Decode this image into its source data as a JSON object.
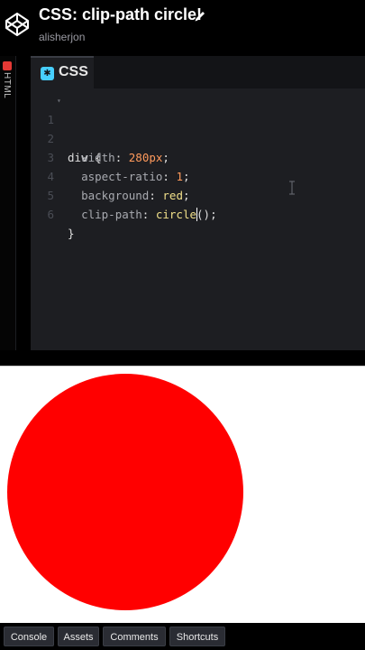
{
  "header": {
    "title": "CSS: clip-path circle!",
    "author": "alisherjon"
  },
  "side_panel": {
    "label": "HTML"
  },
  "editor": {
    "tab_label": "CSS",
    "line_numbers": [
      "1",
      "2",
      "3",
      "4",
      "5",
      "6"
    ],
    "code": {
      "l1_selector": "div {",
      "l2_prop": "width",
      "l2_value": "280px",
      "l3_prop": "aspect-ratio",
      "l3_value": "1",
      "l4_prop": "background",
      "l4_value": "red",
      "l5_prop": "clip-path",
      "l5_fn": "circle",
      "l5_open": "(",
      "l5_close": ");",
      "l6_close": "}"
    }
  },
  "preview": {
    "shape_color": "#ff0000"
  },
  "bottom_bar": {
    "console": "Console",
    "assets": "Assets",
    "comments": "Comments",
    "shortcuts": "Shortcuts"
  },
  "colors": {
    "accent_css": "#47cfff",
    "html_badge": "#e53935",
    "editor_bg": "#1d1e22"
  }
}
